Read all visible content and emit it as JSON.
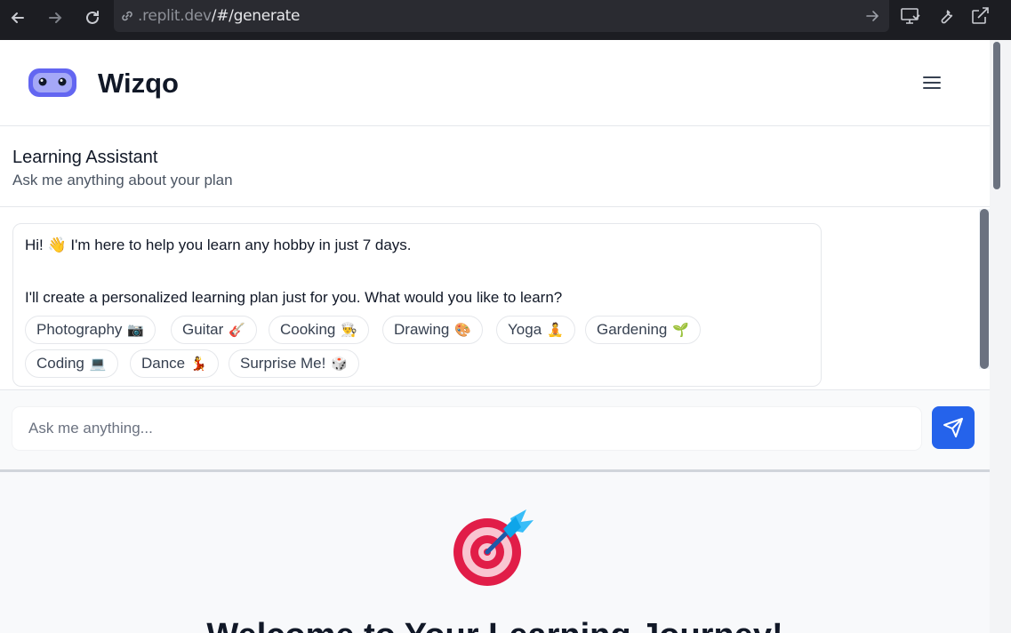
{
  "browser": {
    "url_domain": ".replit.dev",
    "url_path": "/#/generate"
  },
  "header": {
    "brand": "Wizqo"
  },
  "assistant": {
    "title": "Learning Assistant",
    "subtitle": "Ask me anything about your plan"
  },
  "chat": {
    "greeting": "Hi! 👋 I'm here to help you learn any hobby in just 7 days.",
    "prompt": "I'll create a personalized learning plan just for you. What would you like to learn?",
    "suggestions": [
      {
        "label": "Photography",
        "emoji": "📷"
      },
      {
        "label": "Guitar",
        "emoji": "🎸"
      },
      {
        "label": "Cooking",
        "emoji": "👨‍🍳"
      },
      {
        "label": "Drawing",
        "emoji": "🎨"
      },
      {
        "label": "Yoga",
        "emoji": "🧘"
      },
      {
        "label": "Gardening",
        "emoji": "🌱"
      },
      {
        "label": "Coding",
        "emoji": "💻"
      },
      {
        "label": "Dance",
        "emoji": "💃"
      },
      {
        "label": "Surprise Me!",
        "emoji": "🎲"
      }
    ]
  },
  "input": {
    "placeholder": "Ask me anything..."
  },
  "welcome": {
    "title": "Welcome to Your Learning Journey!"
  },
  "colors": {
    "accent": "#2563eb",
    "logo": "#6366f1"
  }
}
